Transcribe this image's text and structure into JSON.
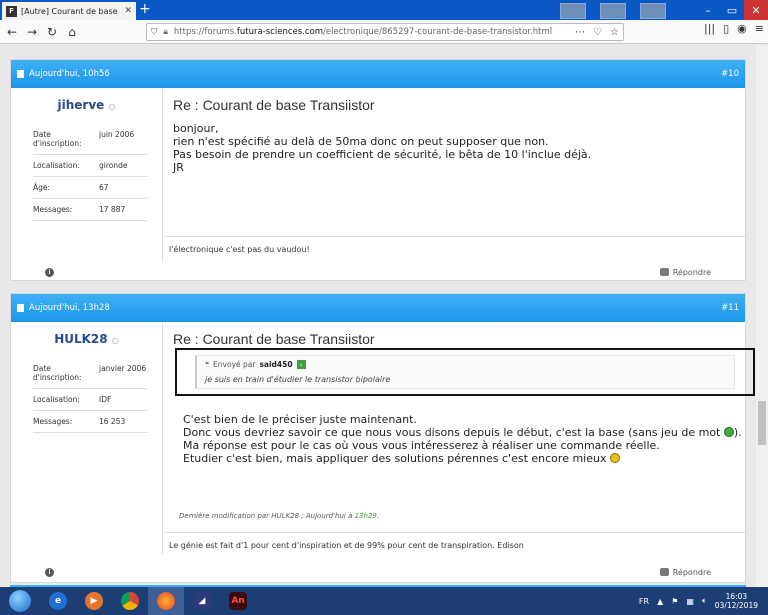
{
  "browser": {
    "tab_title": "[Autre] Courant de base Transi",
    "url_prefix": "https://forums.",
    "url_domain": "futura-sciences.com",
    "url_path": "/electronique/865297-courant-de-base-transistor.html"
  },
  "posts": [
    {
      "date": "Aujourd'hui, 10h56",
      "number": "#10",
      "username": "jiherve",
      "info": [
        {
          "label": "Date d'inscription:",
          "value": "juin 2006"
        },
        {
          "label": "Localisation:",
          "value": "gironde"
        },
        {
          "label": "Âge:",
          "value": "67"
        },
        {
          "label": "Messages:",
          "value": "17 887"
        }
      ],
      "title": "Re : Courant de base Transiistor",
      "body": [
        "bonjour,",
        "rien n'est spécifié au delà de 50ma donc on peut supposer que non.",
        "Pas besoin de prendre un coefficient de sécurité, le bêta de 10 l'inclue déjà.",
        "JR"
      ],
      "signature": "l'électronique c'est pas du vaudou!",
      "reply_label": "Répondre"
    },
    {
      "date": "Aujourd'hui, 13h28",
      "number": "#11",
      "username": "HULK28",
      "info": [
        {
          "label": "Date d'inscription:",
          "value": "janvier 2006"
        },
        {
          "label": "Localisation:",
          "value": "IDF"
        },
        {
          "label": "Messages:",
          "value": "16 253"
        }
      ],
      "title": "Re : Courant de base Transiistor",
      "quote_prefix": "Envoyé par",
      "quote_author": "said450",
      "quote_text": "je suis en train d'étudier le transistor bipolaire",
      "body": [
        "C'est bien de le préciser juste maintenant.",
        "Donc vous devriez savoir ce que nous vous disons depuis le début, c'est la base (sans jeu de mot",
        "Ma réponse est pour le cas où vous vous intéresserez à réaliser une commande réelle.",
        "Etudier c'est bien, mais appliquer des solutions pérennes c'est encore mieux"
      ],
      "body_line2_suffix": ").",
      "edit_prefix": "Dernière modification par HULK28 ; Aujourd'hui à",
      "edit_time": "13h29",
      "edit_suffix": ".",
      "signature": "Le génie est fait d'1 pour cent d'inspiration et de 99% pour cent de transpiration. Edison",
      "reply_label": "Répondre"
    }
  ],
  "taskbar": {
    "lang": "FR",
    "time": "16:03",
    "date": "03/12/2019"
  }
}
